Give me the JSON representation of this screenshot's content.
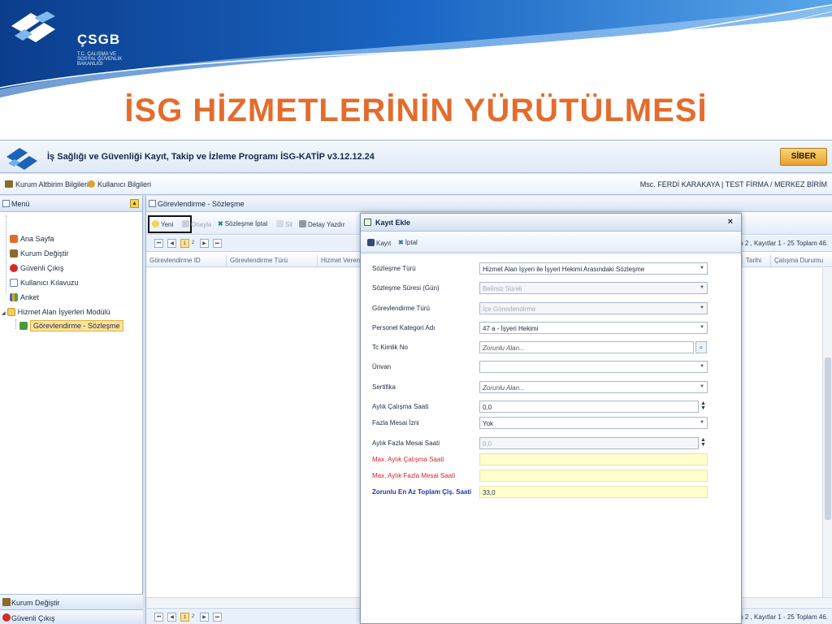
{
  "slide": {
    "logo_text": "ÇSGB",
    "logo_subtitle": "T.C. ÇALIŞMA VE SOSYAL GÜVENLİK BAKANLIĞI",
    "title": "İSG HİZMETLERİNİN YÜRÜTÜLMESİ",
    "title_color": "#e36c2d"
  },
  "app": {
    "title": "İş Sağlığı ve Güvenliği Kayıt, Takip ve İzleme Programı İSG-KATİP v3.12.12.24",
    "brand": "SİBER",
    "menubar": {
      "kurum_altbirim": "Kurum Altbirim Bilgileri",
      "kullanici_bilgileri": "Kullanıcı Bilgileri",
      "user_info": "Msc. FERDİ KARAKAYA | TEST FİRMA / MERKEZ BİRİM"
    }
  },
  "sidebar": {
    "header": "Menü",
    "items": [
      {
        "label": "Ana Sayfa",
        "icon": "home-icon"
      },
      {
        "label": "Kurum Değiştir",
        "icon": "building-icon"
      },
      {
        "label": "Güvenli Çıkış",
        "icon": "exit-icon"
      },
      {
        "label": "Kullanıcı Kılavuzu",
        "icon": "document-icon"
      },
      {
        "label": "Anket",
        "icon": "chart-icon"
      },
      {
        "label": "Hizmet Alan İşyerleri Modülü",
        "icon": "folder-icon"
      },
      {
        "label": "Görevlendirme - Sözleşme",
        "icon": "contract-icon"
      }
    ],
    "footer": [
      {
        "label": "Kurum Değiştir"
      },
      {
        "label": "Güvenli Çıkış"
      }
    ]
  },
  "main": {
    "tab": "Görevlendirme - Sözleşme",
    "toolbar": {
      "yeni": "Yeni",
      "onayla": "Onayla",
      "sozlesme_iptal": "Sözleşme İptal",
      "sil": "Sil",
      "detay_yazdir": "Detay Yazdır"
    },
    "pager": {
      "pages": [
        "1",
        "2"
      ],
      "info": "m 2 , Kayıtlar 1 - 25 Toplam 46."
    },
    "columns": {
      "c1": "Görevlendirme ID",
      "c2": "Görevlendirme Türü",
      "c3": "Hizmet Veren",
      "c4": "Tarihi",
      "c5": "Çalışma Durumu"
    }
  },
  "modal": {
    "title": "Kayıt Ekle",
    "close": "×",
    "kayit": "Kayıt",
    "iptal": "İptal",
    "fields": {
      "sozlesme_turu": {
        "label": "Sözleşme Türü",
        "value": "Hizmet Alan İşyeri ile İşyeri Hekimi Arasındaki Sözleşme"
      },
      "sozlesme_suresi": {
        "label": "Sözleşme Süresi (Gün)",
        "value": "Belirsiz Süreli"
      },
      "gorevlendirme_turu": {
        "label": "Görevlendirme Türü",
        "value": "İçe Görevlendirme"
      },
      "personel_kategori": {
        "label": "Personel Kategori Adı",
        "value": "47 a - İşyeri Hekimi"
      },
      "tc_kimlik": {
        "label": "Tc Kimlik No",
        "value": "Zorunlu Alan..."
      },
      "unvan": {
        "label": "Ünvan",
        "value": ""
      },
      "sertifika": {
        "label": "Sertifika",
        "value": "Zorunlu Alan..."
      },
      "aylik_calisma": {
        "label": "Aylık Çalışma Saati",
        "value": "0,0"
      },
      "fazla_mesai_izni": {
        "label": "Fazla Mesai İzni",
        "value": "Yok"
      },
      "aylik_fazla_mesai": {
        "label": "Aylık Fazla Mesai Saati",
        "value": "0,0"
      },
      "max_aylik_calisma": {
        "label": "Max. Aylık Çalışma Saati",
        "value": ""
      },
      "max_aylik_fazla_mesai": {
        "label": "Max. Aylık Fazla Mesai Saati",
        "value": ""
      },
      "zorunlu_toplam": {
        "label": "Zorunlu En Az Toplam Çlş. Saati",
        "value": "33,0"
      }
    }
  }
}
